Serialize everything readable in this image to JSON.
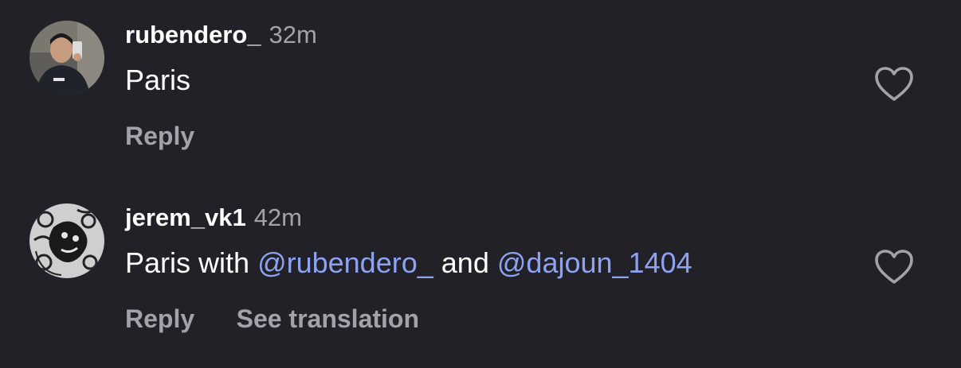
{
  "comments": [
    {
      "username": "rubendero_",
      "time": "32m",
      "text": "Paris",
      "reply_label": "Reply"
    },
    {
      "username": "jerem_vk1",
      "time": "42m",
      "text_prefix": "Paris with",
      "mention1": "@rubendero_",
      "text_mid": "and",
      "mention2": "@dajoun_1404",
      "reply_label": "Reply",
      "translate_label": "See translation"
    }
  ],
  "colors": {
    "background": "#212127",
    "text": "#ffffff",
    "muted": "#a2a2ab",
    "mention": "#8ea2f2"
  },
  "icons": [
    "heart-icon"
  ]
}
